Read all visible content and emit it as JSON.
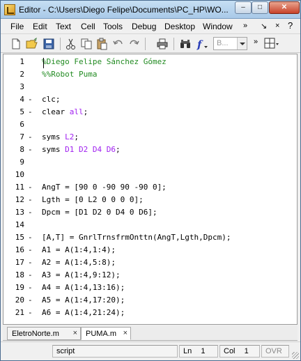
{
  "window": {
    "title": "Editor - C:\\Users\\Diego Felipe\\Documents\\PC_HP\\WO...",
    "min_label": "–",
    "max_label": "□",
    "close_label": "✕"
  },
  "menu": {
    "items": [
      "File",
      "Edit",
      "Text",
      "Cell",
      "Tools",
      "Debug",
      "Desktop",
      "Window"
    ],
    "more": "»",
    "undock": "↘",
    "close": "×"
  },
  "toolbar": {
    "font_placeholder": "B...",
    "more": "»"
  },
  "editor": {
    "lines": [
      {
        "n": "1",
        "mark": "",
        "code": "%Diego Felipe Sánchez Gómez",
        "kind": "comment"
      },
      {
        "n": "2",
        "mark": "",
        "code": "%%Robot Puma",
        "kind": "comment"
      },
      {
        "n": "3",
        "mark": "",
        "code": "",
        "kind": "plain"
      },
      {
        "n": "4",
        "mark": "-",
        "code": "clc;",
        "kind": "plain"
      },
      {
        "n": "5",
        "mark": "-",
        "pre": "clear ",
        "arg": "all",
        "post": ";",
        "kind": "mixed"
      },
      {
        "n": "6",
        "mark": "",
        "code": "",
        "kind": "plain"
      },
      {
        "n": "7",
        "mark": "-",
        "pre": "syms ",
        "arg": "L2",
        "post": ";",
        "kind": "mixed"
      },
      {
        "n": "8",
        "mark": "-",
        "pre": "syms ",
        "arg": "D1 D2 D4 D6",
        "post": ";",
        "kind": "mixed"
      },
      {
        "n": "9",
        "mark": "",
        "code": "",
        "kind": "plain"
      },
      {
        "n": "10",
        "mark": "",
        "code": "",
        "kind": "plain"
      },
      {
        "n": "11",
        "mark": "-",
        "code": "AngT = [90 0 -90 90 -90 0];",
        "kind": "plain"
      },
      {
        "n": "12",
        "mark": "-",
        "code": "Lgth = [0 L2 0 0 0 0];",
        "kind": "plain"
      },
      {
        "n": "13",
        "mark": "-",
        "code": "Dpcm = [D1 D2 0 D4 0 D6];",
        "kind": "plain"
      },
      {
        "n": "14",
        "mark": "",
        "code": "",
        "kind": "plain"
      },
      {
        "n": "15",
        "mark": "-",
        "code": "[A,T] = GnrlTrnsfrmOnttn(AngT,Lgth,Dpcm);",
        "kind": "plain"
      },
      {
        "n": "16",
        "mark": "-",
        "code": "A1 = A(1:4,1:4);",
        "kind": "plain"
      },
      {
        "n": "17",
        "mark": "-",
        "code": "A2 = A(1:4,5:8);",
        "kind": "plain"
      },
      {
        "n": "18",
        "mark": "-",
        "code": "A3 = A(1:4,9:12);",
        "kind": "plain"
      },
      {
        "n": "19",
        "mark": "-",
        "code": "A4 = A(1:4,13:16);",
        "kind": "plain"
      },
      {
        "n": "20",
        "mark": "-",
        "code": "A5 = A(1:4,17:20);",
        "kind": "plain"
      },
      {
        "n": "21",
        "mark": "-",
        "code": "A6 = A(1:4,21:24);",
        "kind": "plain"
      }
    ]
  },
  "tabs": [
    {
      "label": "EletroNorte.m",
      "close": "×",
      "active": false
    },
    {
      "label": "PUMA.m",
      "close": "×",
      "active": true
    }
  ],
  "status": {
    "mode": "script",
    "ln_label": "Ln",
    "ln_value": "1",
    "col_label": "Col",
    "col_value": "1",
    "ovr": "OVR"
  }
}
